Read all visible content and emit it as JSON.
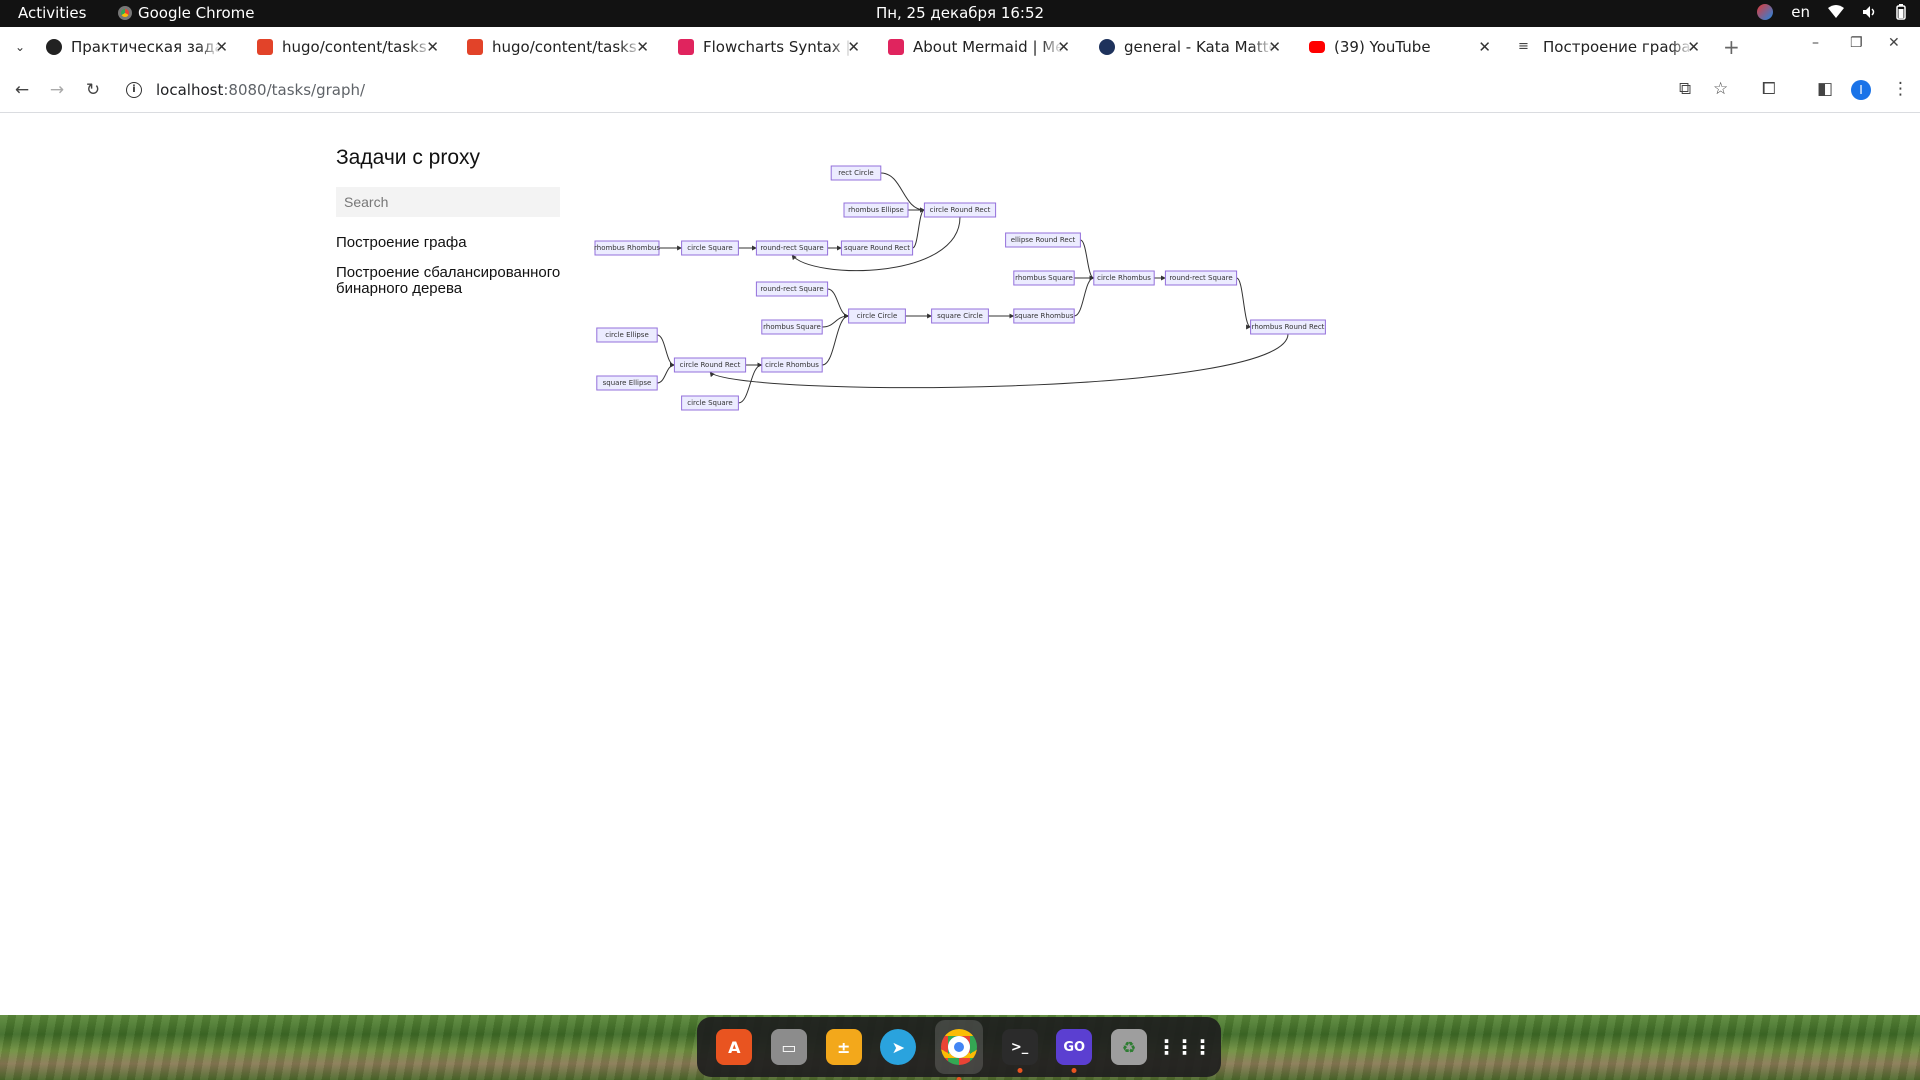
{
  "topbar": {
    "activities": "Activities",
    "app_name": "Google Chrome",
    "clock": "Пн, 25 декабря  16:52",
    "lang": "en"
  },
  "tabs": [
    {
      "label": "Практическая задача",
      "icon": "kata-icon",
      "color": "#222222"
    },
    {
      "label": "hugo/content/tasks",
      "icon": "gitlab-icon",
      "color": "#e24329"
    },
    {
      "label": "hugo/content/tasks",
      "icon": "gitlab-icon",
      "color": "#e24329"
    },
    {
      "label": "Flowcharts Syntax | Mermaid",
      "icon": "mermaid-icon",
      "color": "#e0245e"
    },
    {
      "label": "About Mermaid | Mermaid",
      "icon": "mermaid-icon",
      "color": "#e0245e"
    },
    {
      "label": "general - Kata Mattermost",
      "icon": "mattermost-icon",
      "color": "#1e325c"
    },
    {
      "label": "(39) YouTube",
      "icon": "youtube-icon",
      "color": "#ff0000"
    },
    {
      "label": "Построение графа | ",
      "icon": "page-icon",
      "color": "#444444"
    }
  ],
  "address": {
    "host": "localhost",
    "path": ":8080/tasks/graph/"
  },
  "profile_initial": "I",
  "page": {
    "title": "Задачи с proxy",
    "search_placeholder": "Search",
    "links": [
      "Построение графа",
      "Построение сбалансированного бинарного дерева"
    ]
  },
  "graph": {
    "nodes": [
      {
        "id": "n1",
        "label": "rect Circle"
      },
      {
        "id": "n2",
        "label": "rhombus Ellipse"
      },
      {
        "id": "n3",
        "label": "circle Round Rect"
      },
      {
        "id": "n4",
        "label": "rhombus Rhombus"
      },
      {
        "id": "n5",
        "label": "circle Square"
      },
      {
        "id": "n6",
        "label": "round-rect Square"
      },
      {
        "id": "n7",
        "label": "square Round Rect"
      },
      {
        "id": "n8",
        "label": "ellipse Round Rect"
      },
      {
        "id": "n9",
        "label": "rhombus Square"
      },
      {
        "id": "n10",
        "label": "circle Rhombus"
      },
      {
        "id": "n11",
        "label": "round-rect Square"
      },
      {
        "id": "n12",
        "label": "round-rect Square"
      },
      {
        "id": "n13",
        "label": "rhombus Square"
      },
      {
        "id": "n14",
        "label": "circle Circle"
      },
      {
        "id": "n15",
        "label": "square Circle"
      },
      {
        "id": "n16",
        "label": "square Rhombus"
      },
      {
        "id": "n17",
        "label": "rhombus Round Rect"
      },
      {
        "id": "n18",
        "label": "circle Ellipse"
      },
      {
        "id": "n19",
        "label": "circle Round Rect"
      },
      {
        "id": "n20",
        "label": "circle Rhombus"
      },
      {
        "id": "n21",
        "label": "square Ellipse"
      },
      {
        "id": "n22",
        "label": "circle Square"
      }
    ],
    "edges": [
      [
        "n1",
        "n3"
      ],
      [
        "n2",
        "n3"
      ],
      [
        "n4",
        "n5"
      ],
      [
        "n5",
        "n6"
      ],
      [
        "n6",
        "n7"
      ],
      [
        "n7",
        "n3"
      ],
      [
        "n3",
        "n6"
      ],
      [
        "n8",
        "n10"
      ],
      [
        "n9",
        "n10"
      ],
      [
        "n10",
        "n11"
      ],
      [
        "n11",
        "n17"
      ],
      [
        "n12",
        "n14"
      ],
      [
        "n13",
        "n14"
      ],
      [
        "n14",
        "n15"
      ],
      [
        "n15",
        "n16"
      ],
      [
        "n16",
        "n10"
      ],
      [
        "n18",
        "n19"
      ],
      [
        "n21",
        "n19"
      ],
      [
        "n19",
        "n20"
      ],
      [
        "n20",
        "n14"
      ],
      [
        "n22",
        "n20"
      ],
      [
        "n17",
        "n19"
      ]
    ]
  },
  "dock": [
    {
      "name": "app-center-icon",
      "color": "#e95420",
      "glyph": "A"
    },
    {
      "name": "files-icon",
      "color": "#8c8c8c",
      "glyph": "▭"
    },
    {
      "name": "calculator-icon",
      "color": "#f3a81b",
      "glyph": "±"
    },
    {
      "name": "telegram-icon",
      "color": "#2aa3de",
      "glyph": "➤"
    },
    {
      "name": "chrome-icon",
      "color": "#4285f4",
      "glyph": "◉"
    },
    {
      "name": "terminal-icon",
      "color": "#2b2b2b",
      "glyph": ">_"
    },
    {
      "name": "goland-icon",
      "color": "#5b3fd1",
      "glyph": "GO"
    },
    {
      "name": "trash-icon",
      "color": "#9e9e9e",
      "glyph": "♻"
    },
    {
      "name": "app-grid-icon",
      "color": "transparent",
      "glyph": "⋮⋮⋮"
    }
  ]
}
